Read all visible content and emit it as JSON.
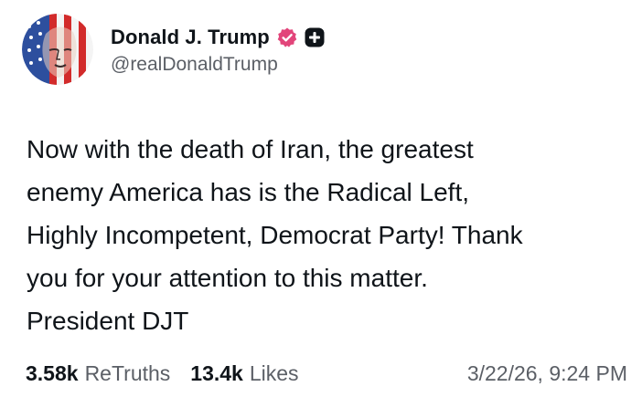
{
  "author": {
    "display_name": "Donald J. Trump",
    "handle": "@realDonaldTrump",
    "verified_icon": "verified-badge-icon",
    "plus_icon": "plus-badge-icon",
    "colors": {
      "verified_badge": "#e2457a",
      "plus_badge": "#0f1419"
    }
  },
  "post": {
    "text": "Now with the death of Iran, the greatest\nenemy America has is the Radical Left,\nHighly Incompetent, Democrat Party! Thank\nyou for your attention to this matter.\nPresident DJT"
  },
  "stats": {
    "retruths_count": "3.58k",
    "retruths_label": "ReTruths",
    "likes_count": "13.4k",
    "likes_label": "Likes",
    "timestamp": "3/22/26, 9:24 PM"
  }
}
